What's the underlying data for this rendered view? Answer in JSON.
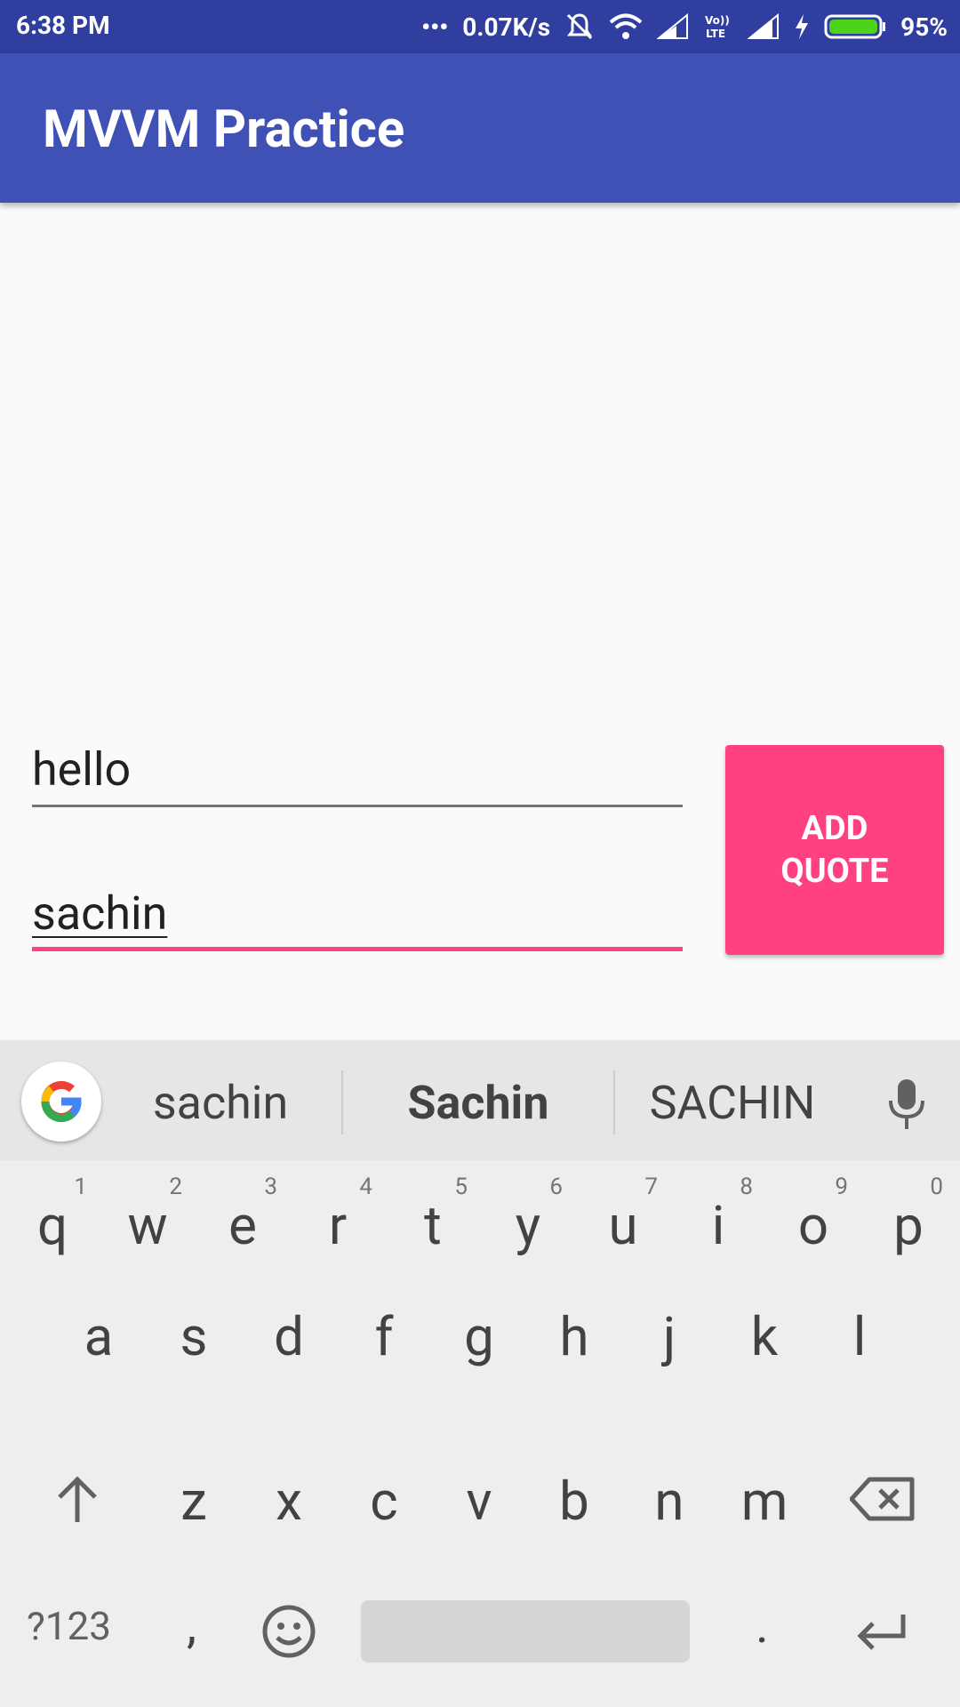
{
  "status_bar": {
    "time": "6:38 PM",
    "network_speed": "0.07K/s",
    "battery": "95%",
    "icons": [
      "more-icon",
      "mute-icon",
      "wifi-icon",
      "signal-icon",
      "volte-icon",
      "signal-icon",
      "charging-icon",
      "battery-icon"
    ]
  },
  "app_bar": {
    "title": "MVVM Practice"
  },
  "form": {
    "quote_value": "hello",
    "author_value": "sachin",
    "add_button_line1": "ADD",
    "add_button_line2": "QUOTE"
  },
  "keyboard": {
    "suggestions": [
      "sachin",
      "Sachin",
      "SACHIN"
    ],
    "row1": [
      {
        "ch": "q",
        "hint": "1"
      },
      {
        "ch": "w",
        "hint": "2"
      },
      {
        "ch": "e",
        "hint": "3"
      },
      {
        "ch": "r",
        "hint": "4"
      },
      {
        "ch": "t",
        "hint": "5"
      },
      {
        "ch": "y",
        "hint": "6"
      },
      {
        "ch": "u",
        "hint": "7"
      },
      {
        "ch": "i",
        "hint": "8"
      },
      {
        "ch": "o",
        "hint": "9"
      },
      {
        "ch": "p",
        "hint": "0"
      }
    ],
    "row2": [
      "a",
      "s",
      "d",
      "f",
      "g",
      "h",
      "j",
      "k",
      "l"
    ],
    "row3": [
      "z",
      "x",
      "c",
      "v",
      "b",
      "n",
      "m"
    ],
    "sym_label": "?123",
    "comma": ",",
    "period": "."
  },
  "colors": {
    "primary": "#3f51b5",
    "primary_dark": "#303f9f",
    "accent": "#ff4081"
  }
}
